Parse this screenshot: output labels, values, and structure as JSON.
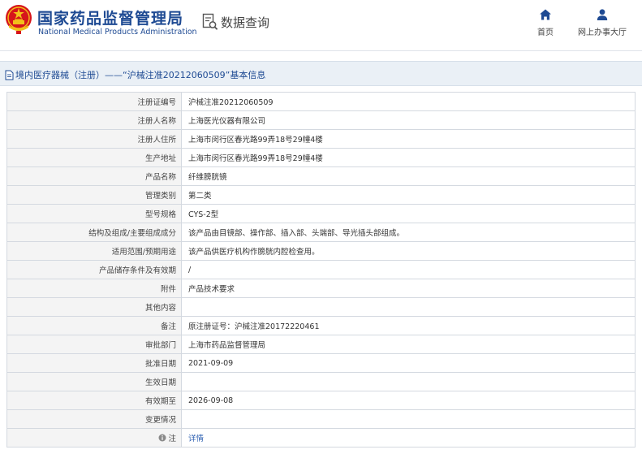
{
  "header": {
    "title_cn": "国家药品监督管理局",
    "title_en": "National Medical Products Administration",
    "query_label": "数据查询",
    "nav": [
      {
        "label": "首页",
        "icon": "home-icon"
      },
      {
        "label": "网上办事大厅",
        "icon": "user-icon"
      }
    ]
  },
  "breadcrumb": {
    "text": "境内医疗器械（注册）——“沪械注准20212060509”基本信息"
  },
  "rows": [
    {
      "label": "注册证编号",
      "value": "沪械注准20212060509"
    },
    {
      "label": "注册人名称",
      "value": "上海医光仪器有限公司"
    },
    {
      "label": "注册人住所",
      "value": "上海市闵行区春光路99弄18号29幢4楼"
    },
    {
      "label": "生产地址",
      "value": "上海市闵行区春光路99弄18号29幢4楼"
    },
    {
      "label": "产品名称",
      "value": "纤维膀胱镜"
    },
    {
      "label": "管理类别",
      "value": "第二类"
    },
    {
      "label": "型号规格",
      "value": "CYS-2型"
    },
    {
      "label": "结构及组成/主要组成成分",
      "value": "该产品由目镜部、操作部、插入部、头端部、导光插头部组成。"
    },
    {
      "label": "适用范围/预期用途",
      "value": "该产品供医疗机构作膀胱内腔检查用。"
    },
    {
      "label": "产品储存条件及有效期",
      "value": "/"
    },
    {
      "label": "附件",
      "value": "产品技术要求"
    },
    {
      "label": "其他内容",
      "value": ""
    },
    {
      "label": "备注",
      "value": "原注册证号：沪械注准20172220461"
    },
    {
      "label": "审批部门",
      "value": "上海市药品监督管理局"
    },
    {
      "label": "批准日期",
      "value": "2021-09-09"
    },
    {
      "label": "生效日期",
      "value": ""
    },
    {
      "label": "有效期至",
      "value": "2026-09-08"
    },
    {
      "label": "变更情况",
      "value": ""
    },
    {
      "label": "注",
      "value": "详情",
      "label_icon": "info-icon"
    }
  ],
  "colors": {
    "brand_blue": "#1e4a93",
    "emblem_red": "#d6151b",
    "emblem_gold": "#f2c01a",
    "band_bg": "#eaf0f6"
  }
}
